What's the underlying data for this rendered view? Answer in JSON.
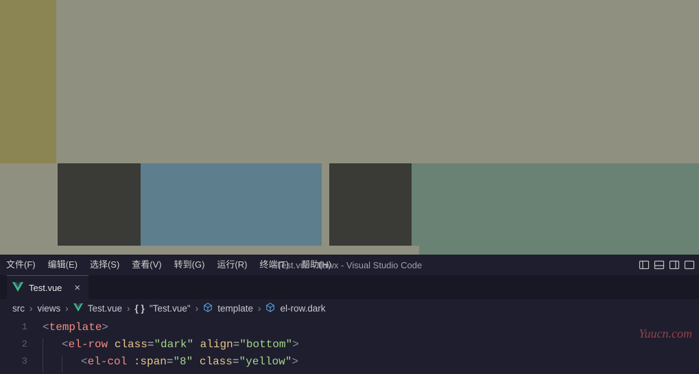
{
  "upper_blocks": {
    "colors": {
      "bg": "#909080",
      "yellow": "#8a8553",
      "dark": "#3a3a37",
      "blue": "#5d7e8c",
      "green": "#6a8273"
    }
  },
  "menubar": {
    "items": [
      "文件(F)",
      "编辑(E)",
      "选择(S)",
      "查看(V)",
      "转到(G)",
      "运行(R)",
      "终端(T)",
      "帮助(H)"
    ]
  },
  "window_title": "Test.vue - flawx - Visual Studio Code",
  "tab": {
    "label": "Test.vue",
    "icon": "vue-icon",
    "close": "×"
  },
  "breadcrumb": {
    "parts": [
      "src",
      "views",
      "Test.vue",
      "\"Test.vue\"",
      "template",
      "el-row.dark"
    ]
  },
  "code": {
    "lines": [
      {
        "n": "1",
        "tokens": [
          {
            "t": "<",
            "c": "tk-bracket"
          },
          {
            "t": "template",
            "c": "tk-tag"
          },
          {
            "t": ">",
            "c": "tk-bracket"
          }
        ],
        "indent": 0
      },
      {
        "n": "2",
        "tokens": [
          {
            "t": "<",
            "c": "tk-bracket"
          },
          {
            "t": "el-row",
            "c": "tk-tag"
          },
          {
            "t": " ",
            "c": ""
          },
          {
            "t": "class",
            "c": "tk-attr"
          },
          {
            "t": "=",
            "c": "tk-eq"
          },
          {
            "t": "\"dark\"",
            "c": "tk-str"
          },
          {
            "t": " ",
            "c": ""
          },
          {
            "t": "align",
            "c": "tk-attr"
          },
          {
            "t": "=",
            "c": "tk-eq"
          },
          {
            "t": "\"bottom\"",
            "c": "tk-str"
          },
          {
            "t": ">",
            "c": "tk-bracket"
          }
        ],
        "indent": 1
      },
      {
        "n": "3",
        "tokens": [
          {
            "t": "<",
            "c": "tk-bracket"
          },
          {
            "t": "el-col",
            "c": "tk-tag"
          },
          {
            "t": " ",
            "c": ""
          },
          {
            "t": ":span",
            "c": "tk-attr"
          },
          {
            "t": "=",
            "c": "tk-eq"
          },
          {
            "t": "\"8\"",
            "c": "tk-str"
          },
          {
            "t": " ",
            "c": ""
          },
          {
            "t": "class",
            "c": "tk-attr"
          },
          {
            "t": "=",
            "c": "tk-eq"
          },
          {
            "t": "\"yellow\"",
            "c": "tk-str"
          },
          {
            "t": ">",
            "c": "tk-bracket"
          }
        ],
        "indent": 2
      }
    ]
  },
  "watermark": "Yuucn.com"
}
